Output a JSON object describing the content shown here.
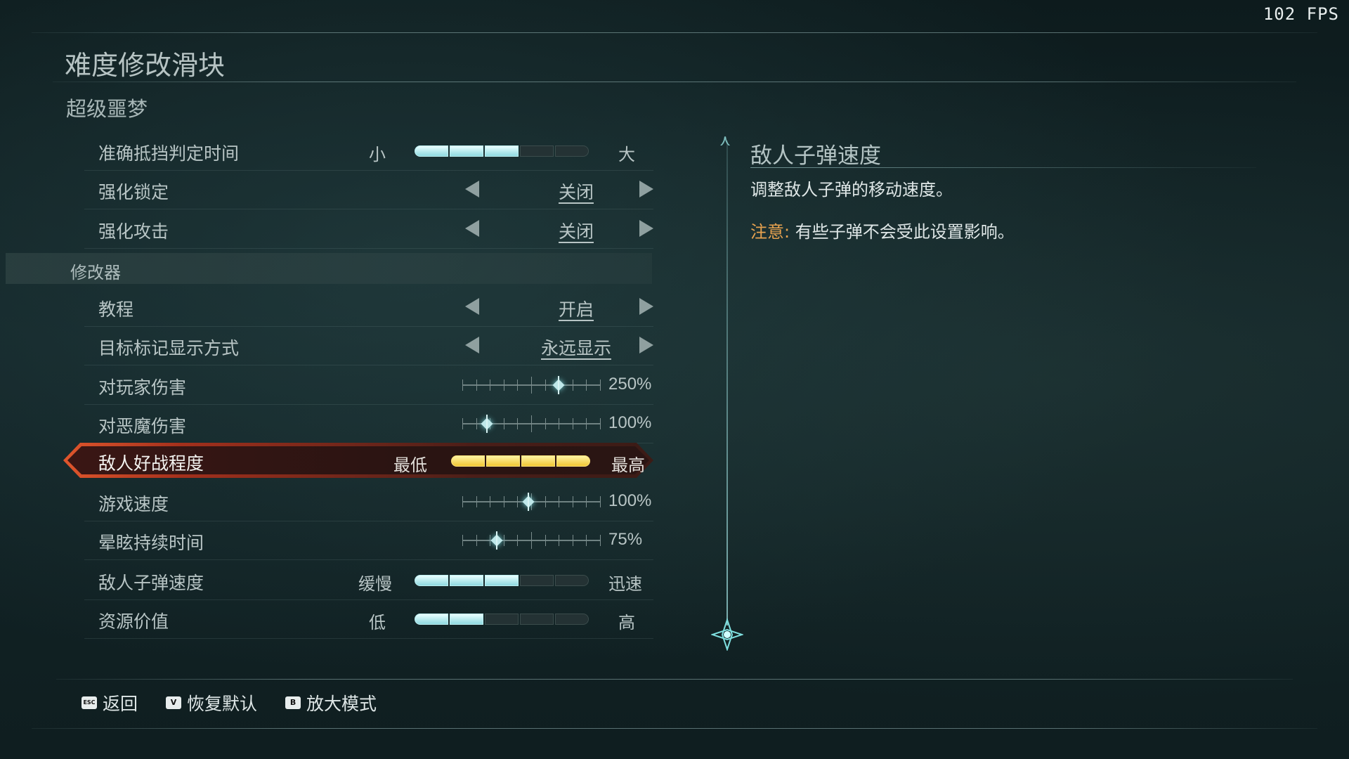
{
  "fps": "102 FPS",
  "page_title": "难度修改滑块",
  "preset_title": "超级噩梦",
  "section_modifiers": "修改器",
  "rows": [
    {
      "label": "准确抵挡判定时间",
      "type": "segments",
      "low": "小",
      "high": "大",
      "level": 3,
      "max": 5
    },
    {
      "label": "强化锁定",
      "type": "choice",
      "value": "关闭"
    },
    {
      "label": "强化攻击",
      "type": "choice",
      "value": "关闭"
    },
    {
      "label": "教程",
      "type": "choice",
      "value": "开启"
    },
    {
      "label": "目标标记显示方式",
      "type": "choice",
      "value": "永远显示"
    },
    {
      "label": "对玩家伤害",
      "type": "ticks",
      "value": "250%",
      "fraction": 0.7
    },
    {
      "label": "对恶魔伤害",
      "type": "ticks",
      "value": "100%",
      "fraction": 0.18
    },
    {
      "label": "敌人好战程度",
      "type": "segments",
      "low": "最低",
      "high": "最高",
      "level": 4,
      "max": 4,
      "selected": true
    },
    {
      "label": "游戏速度",
      "type": "ticks",
      "value": "100%",
      "fraction": 0.48
    },
    {
      "label": "晕眩持续时间",
      "type": "ticks",
      "value": "75%",
      "fraction": 0.25
    },
    {
      "label": "敌人子弹速度",
      "type": "segments",
      "low": "缓慢",
      "high": "迅速",
      "level": 3,
      "max": 5
    },
    {
      "label": "资源价值",
      "type": "segments",
      "low": "低",
      "high": "高",
      "level": 2,
      "max": 5
    }
  ],
  "detail": {
    "title": "敌人子弹速度",
    "description": "调整敌人子弹的移动速度。",
    "note_label": "注意:",
    "note_text": "有些子弹不会受此设置影响。"
  },
  "footer": {
    "back_key": "ESC",
    "back_label": "返回",
    "reset_key": "V",
    "reset_label": "恢复默认",
    "zoom_key": "B",
    "zoom_label": "放大模式"
  },
  "colors": {
    "accent_selected": "#e0562c",
    "segment_on": "#8fd9e0",
    "segment_gold": "#f1c634",
    "note": "#e7a24f"
  }
}
